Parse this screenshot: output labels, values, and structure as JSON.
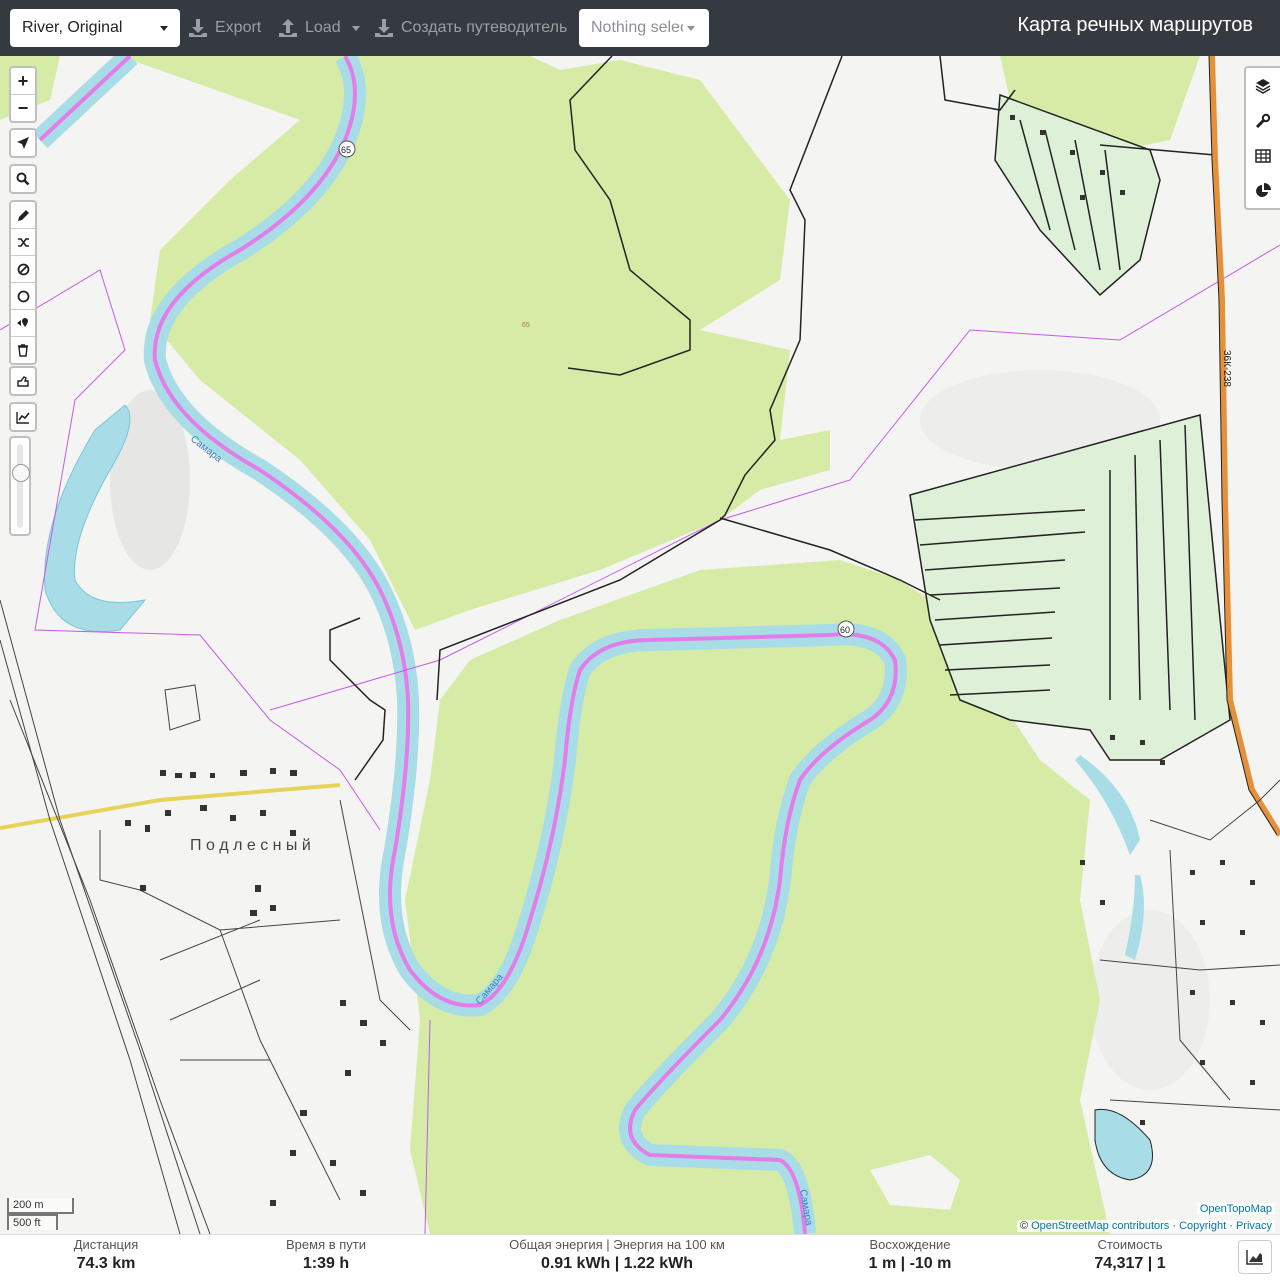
{
  "toolbar": {
    "profile": "River, Original",
    "export": "Export",
    "load": "Load",
    "guide": "Создать путеводитель",
    "selection": "Nothing selected",
    "title": "Карта речных маршрутов"
  },
  "map": {
    "river_label_1": "Самара",
    "river_label_2": "Самара",
    "river_label_3": "Самара",
    "village_label": "П о д л е с н ы й",
    "road_label": "36К-238",
    "km_marker_1": "65",
    "km_marker_2": "60",
    "contour_label": "65"
  },
  "controls": {
    "zoom_in": "+",
    "zoom_out": "−"
  },
  "scale": {
    "metric": "200 m",
    "imperial": "500 ft"
  },
  "attribution": {
    "tiles": "OpenTopoMap",
    "osm": "OpenStreetMap contributors",
    "sep1": " · ",
    "copyright": "Copyright",
    "privacy": "Privacy"
  },
  "stats": [
    {
      "label": "Дистанция",
      "value": "74.3 km"
    },
    {
      "label": "Время в пути",
      "value": "1:39 h"
    },
    {
      "label": "Общая энергия | Энергия на 100 км",
      "value": "0.91 kWh | 1.22 kWh"
    },
    {
      "label": "Восхождение",
      "value": "1 m | -10 m"
    },
    {
      "label": "Стоимость",
      "value": "74,317 | 1"
    }
  ]
}
